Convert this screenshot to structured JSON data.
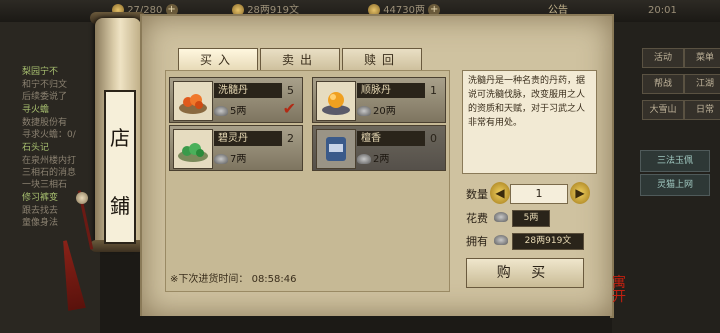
{
  "topbar": {
    "stat1": "27/280",
    "stat2": "28两919文",
    "stat3": "44730两",
    "notice": "公告",
    "time": "20:01"
  },
  "left_quests": [
    {
      "text": "梨园宁不",
      "title": true
    },
    {
      "text": "和宁不归文",
      "title": false
    },
    {
      "text": "后续委说了",
      "title": false
    },
    {
      "text": "寻火蟾",
      "title": true
    },
    {
      "text": "数捷股份有",
      "title": false
    },
    {
      "text": "寻求火蟾：0/",
      "title": false
    },
    {
      "text": "石头记",
      "title": true
    },
    {
      "text": "在泉州楼内打",
      "title": false
    },
    {
      "text": "三相石的消息",
      "title": false
    },
    {
      "text": "一块三相石",
      "title": false
    },
    {
      "text": "修习裤变",
      "title": true
    },
    {
      "text": "跟去找去",
      "title": false
    },
    {
      "text": "童像身法",
      "title": false
    }
  ],
  "right_panel": {
    "buttons": [
      "活动",
      "菜单",
      "帮战",
      "江湖",
      "大雪山",
      "日常"
    ],
    "list": [
      "三法玉佩",
      "灵猫上网"
    ]
  },
  "shop_title": [
    "店",
    "鋪"
  ],
  "tabs": {
    "buy": "买入",
    "sell": "卖出",
    "redeem": "赎回"
  },
  "items": [
    {
      "name": "洗髓丹",
      "count": "5",
      "price": "5两",
      "selected": true
    },
    {
      "name": "顺脉丹",
      "count": "1",
      "price": "20两",
      "selected": false
    },
    {
      "name": "碧灵丹",
      "count": "2",
      "price": "7两",
      "selected": false
    },
    {
      "name": "檀香",
      "count": "0",
      "price": "2两",
      "selected": false,
      "disabled": true
    }
  ],
  "description": "洗髓丹是一种名贵的丹药，据说可洗髓伐脉，改变服用之人的资质和天赋，对于习武之人非常有用处。",
  "labels": {
    "quantity": "数量",
    "cost": "花费",
    "owned": "拥有"
  },
  "quantity": "1",
  "cost_value": "5两",
  "owned_value": "28两919文",
  "buy_button": "购 买",
  "restock_label": "※下次进货时间：",
  "restock_time": "08:58:46",
  "seal_text": "寓开",
  "icons": {
    "decrement": "◀",
    "increment": "▶",
    "checkmark": "✔"
  }
}
